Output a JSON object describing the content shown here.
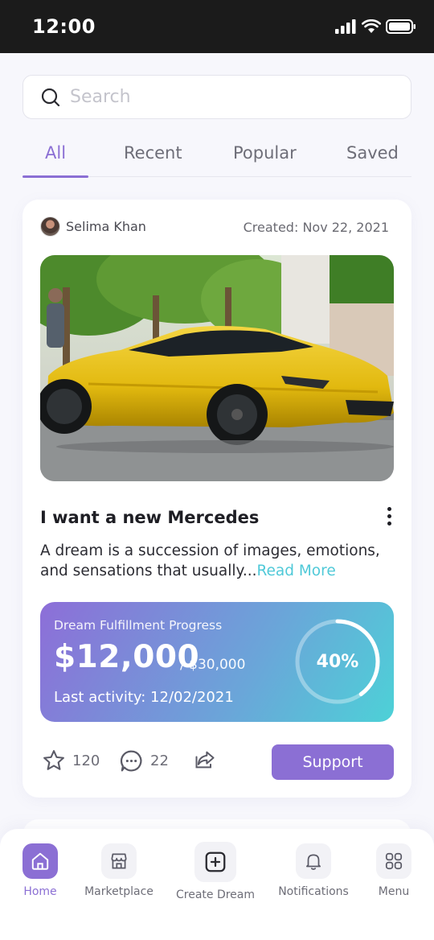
{
  "status_bar": {
    "time": "12:00"
  },
  "search": {
    "placeholder": "Search",
    "value": ""
  },
  "tabs": [
    {
      "label": "All",
      "active": true
    },
    {
      "label": "Recent",
      "active": false
    },
    {
      "label": "Popular",
      "active": false
    },
    {
      "label": "Saved",
      "active": false
    }
  ],
  "post": {
    "author": "Selima Khan",
    "created_label": "Created:",
    "created_date": "Nov 22, 2021",
    "title": "I want a new Mercedes",
    "description": "A dream is a succession of images, emotions, and sensations that usually...",
    "read_more": "Read More",
    "progress": {
      "label": "Dream Fulfillment Progress",
      "raised": "$12,000",
      "goal": "/ $30,000",
      "last_activity": "Last activity: 12/02/2021",
      "percent_label": "40%",
      "percent": 40
    },
    "stars": "120",
    "comments": "22",
    "support_label": "Support"
  },
  "bottom_nav": [
    {
      "label": "Home",
      "icon": "home-icon",
      "active": true
    },
    {
      "label": "Marketplace",
      "icon": "store-icon",
      "active": false
    },
    {
      "label": "Create Dream",
      "icon": "plus-square-icon",
      "active": false
    },
    {
      "label": "Notifications",
      "icon": "bell-icon",
      "active": false
    },
    {
      "label": "Menu",
      "icon": "grid-icon",
      "active": false
    }
  ],
  "colors": {
    "accent": "#8b6fd4",
    "link": "#4fc9d8",
    "gradient_start": "#8d6ed8",
    "gradient_end": "#4dd1d7"
  }
}
